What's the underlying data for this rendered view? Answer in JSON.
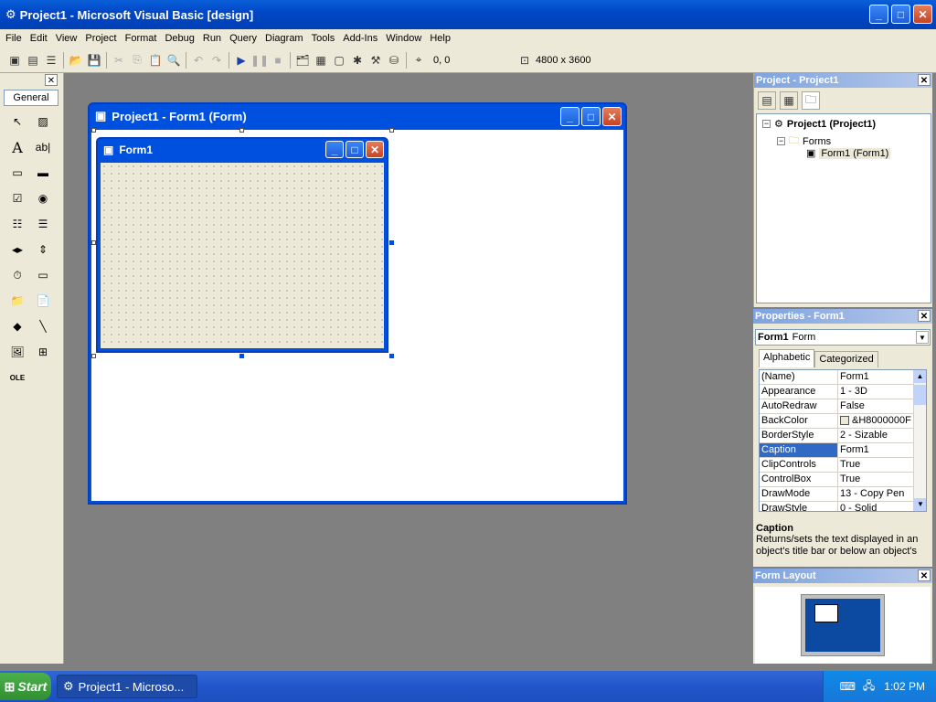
{
  "window": {
    "title": "Project1 - Microsoft Visual Basic [design]"
  },
  "menu": [
    "File",
    "Edit",
    "View",
    "Project",
    "Format",
    "Debug",
    "Run",
    "Query",
    "Diagram",
    "Tools",
    "Add-Ins",
    "Window",
    "Help"
  ],
  "toolbar": {
    "position": "0, 0",
    "size": "4800 x 3600"
  },
  "toolbox": {
    "tab": "General"
  },
  "form_designer": {
    "title": "Project1 - Form1 (Form)",
    "form_caption": "Form1"
  },
  "project": {
    "title": "Project - Project1",
    "root": "Project1 (Project1)",
    "folder": "Forms",
    "item": "Form1 (Form1)"
  },
  "properties": {
    "title": "Properties - Form1",
    "object": "Form1",
    "object_type": "Form",
    "tabs": [
      "Alphabetic",
      "Categorized"
    ],
    "rows": [
      {
        "name": "(Name)",
        "value": "Form1"
      },
      {
        "name": "Appearance",
        "value": "1 - 3D"
      },
      {
        "name": "AutoRedraw",
        "value": "False"
      },
      {
        "name": "BackColor",
        "value": "&H8000000F"
      },
      {
        "name": "BorderStyle",
        "value": "2 - Sizable"
      },
      {
        "name": "Caption",
        "value": "Form1"
      },
      {
        "name": "ClipControls",
        "value": "True"
      },
      {
        "name": "ControlBox",
        "value": "True"
      },
      {
        "name": "DrawMode",
        "value": "13 - Copy Pen"
      },
      {
        "name": "DrawStyle",
        "value": "0 - Solid"
      }
    ],
    "selected_row": "Caption",
    "desc_title": "Caption",
    "desc_text": "Returns/sets the text displayed in an object's title bar or below an object's"
  },
  "layout": {
    "title": "Form Layout"
  },
  "taskbar": {
    "start": "Start",
    "item": "Project1 - Microso...",
    "time": "1:02 PM"
  }
}
